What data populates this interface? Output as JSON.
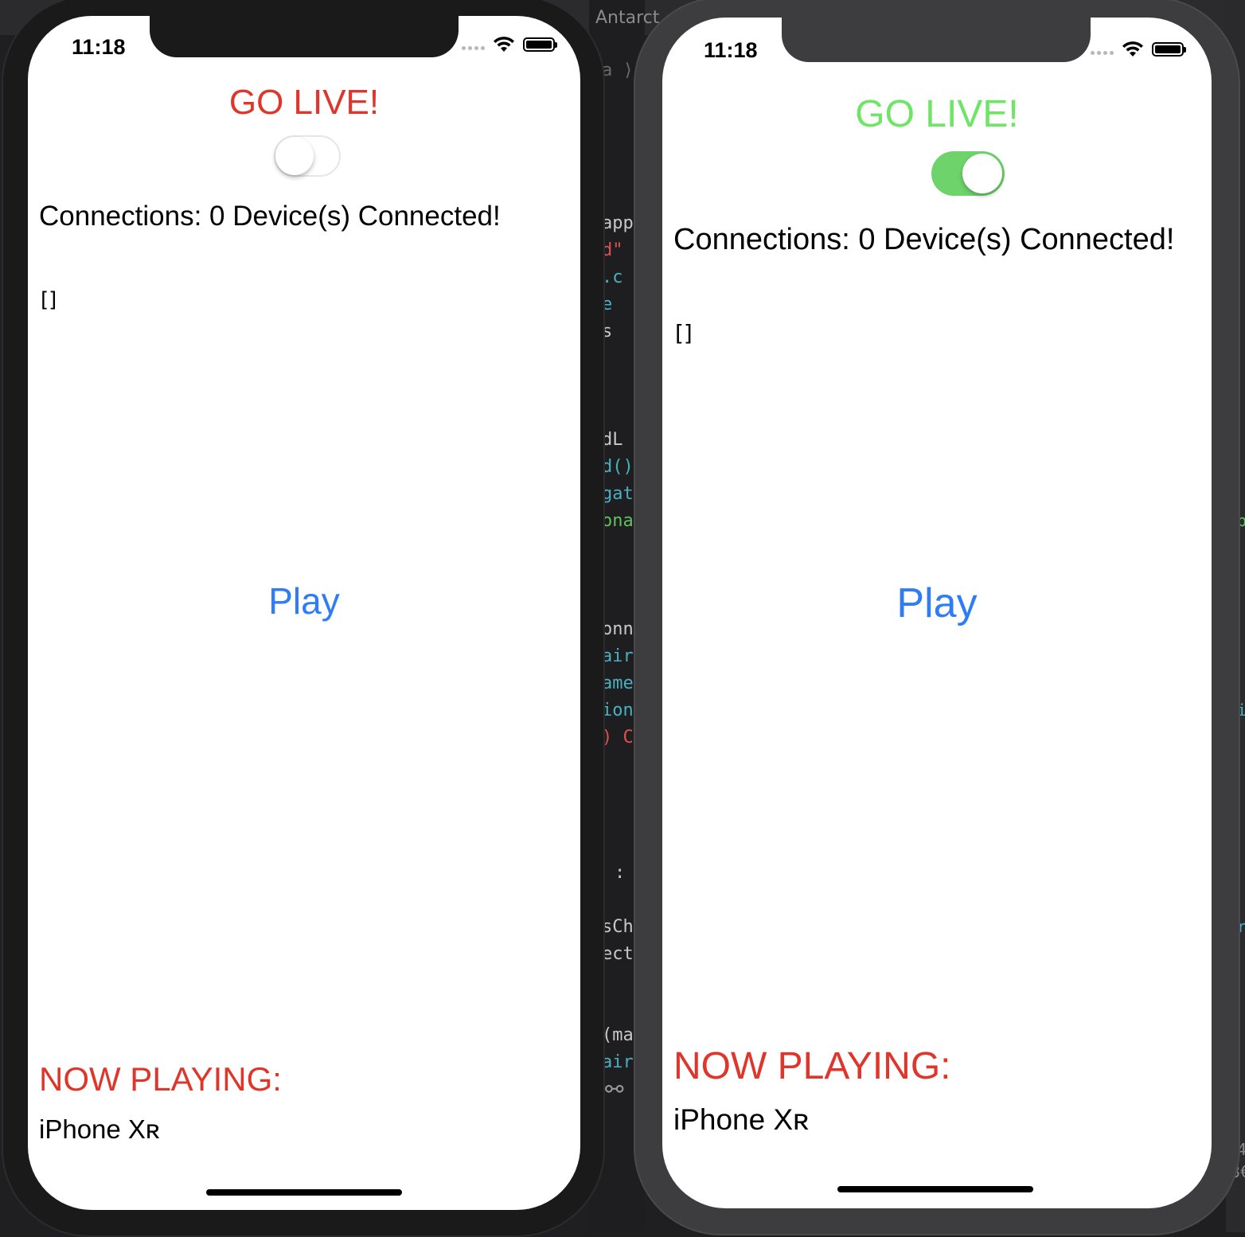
{
  "background": {
    "window_title": "Antarct",
    "breadcrumb": "a ⟩",
    "code_lines": [
      {
        "text": "app",
        "color": "#c8c8cc"
      },
      {
        "text": "d\"",
        "color": "#e05050"
      },
      {
        "text": ".c",
        "color": "#49b0c0"
      },
      {
        "text": "e",
        "color": "#49b0c0"
      },
      {
        "text": "s",
        "color": "#c8c8cc"
      },
      {
        "text": "dL",
        "color": "#c8c8cc"
      },
      {
        "text": "d()",
        "color": "#49b0c0"
      },
      {
        "text": "gat",
        "color": "#49b0c0"
      },
      {
        "text": "ona",
        "color": "#63c060"
      },
      {
        "text": "onn",
        "color": "#c8c8cc"
      },
      {
        "text": "air",
        "color": "#49b0c0"
      },
      {
        "text": "ame",
        "color": "#49b0c0"
      },
      {
        "text": "ion",
        "color": "#49b0c0"
      },
      {
        "text": ") C",
        "color": "#e05050"
      },
      {
        "text": ":",
        "color": "#c8c8cc"
      },
      {
        "text": "sCh",
        "color": "#c8c8cc"
      },
      {
        "text": "ect",
        "color": "#c8c8cc"
      },
      {
        "text": "(ma",
        "color": "#c8c8cc"
      },
      {
        "text": "air",
        "color": "#49b0c0"
      }
    ],
    "right_glyphs": [
      {
        "text": "b",
        "color": "#63c060"
      },
      {
        "text": "i",
        "color": "#49b0c0"
      },
      {
        "text": "r",
        "color": "#49b0c0"
      },
      {
        "text": "4",
        "color": "#8a8a8e"
      },
      {
        "text": "3€",
        "color": "#8a8a8e"
      }
    ],
    "hub_icon": "⚯"
  },
  "phones": [
    {
      "status": {
        "time": "11:18"
      },
      "go_live": {
        "label": "GO LIVE!",
        "color": "#e0352b",
        "toggle_on": false
      },
      "connections": "Connections: 0 Device(s) Connected!",
      "peers": "[]",
      "play_label": "Play",
      "now_playing_label": "NOW PLAYING:",
      "device_name": "iPhone Xʀ"
    },
    {
      "status": {
        "time": "11:18"
      },
      "go_live": {
        "label": "GO LIVE!",
        "color": "#6ee565",
        "toggle_on": true
      },
      "connections": "Connections: 0 Device(s) Connected!",
      "peers": "[]",
      "play_label": "Play",
      "now_playing_label": "NOW PLAYING:",
      "device_name": "iPhone Xʀ"
    }
  ],
  "colors": {
    "accent_red": "#e0352b",
    "accent_green": "#6ee565",
    "toggle_green": "#6dd36a",
    "link_blue": "#2e7cf6"
  },
  "icons": [
    "wifi-icon",
    "battery-icon",
    "signal-icon"
  ]
}
